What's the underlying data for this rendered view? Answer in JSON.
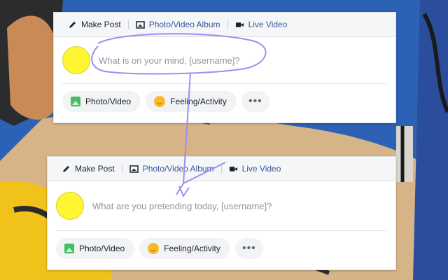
{
  "top_card": {
    "tabs": [
      {
        "label": "Make Post",
        "icon": "pencil-icon"
      },
      {
        "label": "Photo/Video Album",
        "icon": "album-icon"
      },
      {
        "label": "Live Video",
        "icon": "video-camera-icon"
      }
    ],
    "prompt_placeholder": "What is on your mind, [username]?",
    "actions": [
      {
        "label": "Photo/Video",
        "icon": "photo-icon"
      },
      {
        "label": "Feeling/Activity",
        "icon": "smiley-icon"
      },
      {
        "label": "•••",
        "icon": "more-icon"
      }
    ]
  },
  "bottom_card": {
    "tabs": [
      {
        "label": "Make Post",
        "icon": "pencil-icon"
      },
      {
        "label": "Photo/Video Album",
        "icon": "album-icon"
      },
      {
        "label": "Live Video",
        "icon": "video-camera-icon"
      }
    ],
    "prompt_placeholder": "What are you pretending today, [username]?",
    "actions": [
      {
        "label": "Photo/Video",
        "icon": "photo-icon"
      },
      {
        "label": "Feeling/Activity",
        "icon": "smiley-icon"
      },
      {
        "label": "•••",
        "icon": "more-icon"
      }
    ]
  },
  "colors": {
    "link": "#365899",
    "avatar": "#fff533",
    "annotation": "#9b8ff0"
  }
}
